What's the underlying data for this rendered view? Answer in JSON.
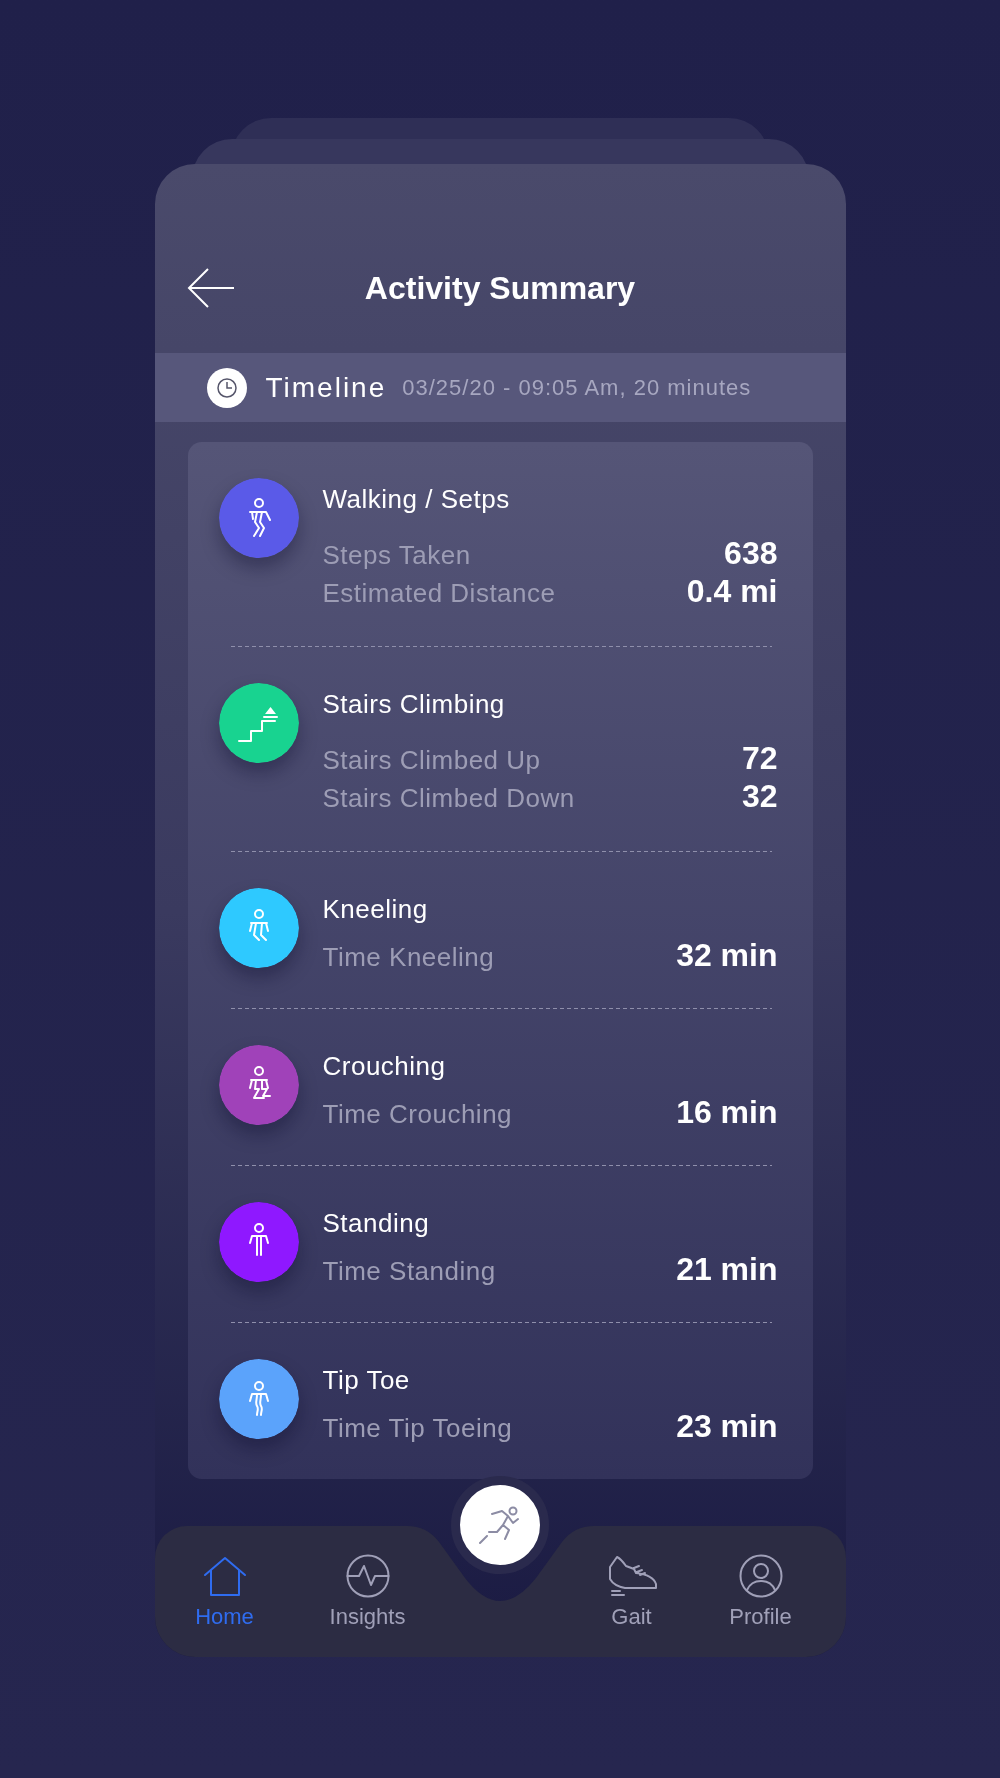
{
  "header": {
    "title": "Activity Summary"
  },
  "timeline": {
    "label": "Timeline",
    "detail": "03/25/20 - 09:05 Am, 20 minutes"
  },
  "activities": [
    {
      "kind": "walking",
      "color": "#5a5ae8",
      "title": "Walking / Setps",
      "metrics": [
        {
          "label": "Steps Taken",
          "value": "638"
        },
        {
          "label": "Estimated Distance",
          "value": "0.4 mi"
        }
      ]
    },
    {
      "kind": "stairs",
      "color": "#18d390",
      "title": "Stairs Climbing",
      "metrics": [
        {
          "label": "Stairs Climbed Up",
          "value": "72"
        },
        {
          "label": "Stairs Climbed Down",
          "value": "32"
        }
      ]
    },
    {
      "kind": "kneeling",
      "color": "#2ec9ff",
      "title": "Kneeling",
      "metrics": [
        {
          "label": "Time Kneeling",
          "value": "32 min"
        }
      ]
    },
    {
      "kind": "crouching",
      "color": "#a042b9",
      "title": "Crouching",
      "metrics": [
        {
          "label": "Time Crouching",
          "value": "16 min"
        }
      ]
    },
    {
      "kind": "standing",
      "color": "#8f18ff",
      "title": "Standing",
      "metrics": [
        {
          "label": "Time Standing",
          "value": "21 min"
        }
      ]
    },
    {
      "kind": "tiptoe",
      "color": "#5ba3fb",
      "title": "Tip Toe",
      "metrics": [
        {
          "label": "Time Tip Toeing",
          "value": "23 min"
        }
      ]
    }
  ],
  "nav": [
    {
      "kind": "home",
      "label": "Home",
      "selected": true
    },
    {
      "kind": "insights",
      "label": "Insights",
      "selected": false
    },
    {
      "kind": "gait",
      "label": "Gait",
      "selected": false
    },
    {
      "kind": "profile",
      "label": "Profile",
      "selected": false
    }
  ]
}
